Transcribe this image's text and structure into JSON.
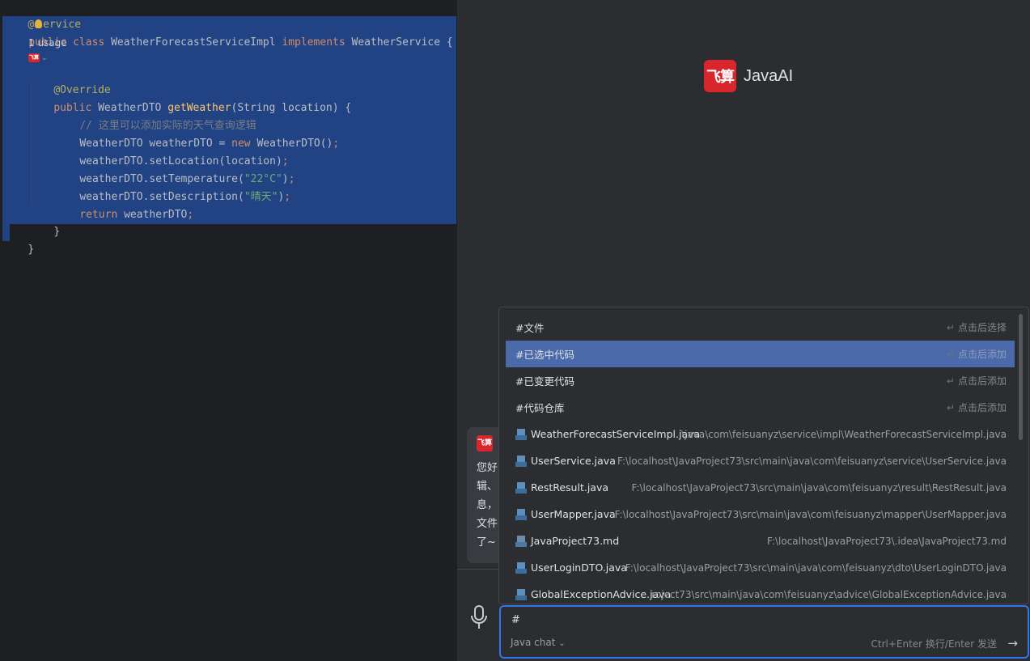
{
  "editor": {
    "lines": {
      "l0": {
        "at": "@",
        "rest": "ervice"
      },
      "l1": {
        "k1": "public",
        "k2": "class",
        "name": "WeatherForecastServiceImpl",
        "k3": "implements",
        "iface": "WeatherService",
        "brace": "{"
      },
      "usage": "1 usage",
      "l3": "@Override",
      "l4": {
        "k1": "public",
        "type": "WeatherDTO",
        "fn": "getWeather",
        "args": "(String location) {"
      },
      "l5": "// 这里可以添加实际的天气查询逻辑",
      "l6": {
        "a": "WeatherDTO weatherDTO = ",
        "kw": "new",
        "b": " WeatherDTO()",
        "semi": ";"
      },
      "l7": {
        "a": "weatherDTO.setLocation(location)",
        "semi": ";"
      },
      "l8": {
        "a": "weatherDTO.setTemperature(",
        "s": "\"22°C\"",
        "b": ")",
        "semi": ";"
      },
      "l9": {
        "a": "weatherDTO.setDescription(",
        "s": "\"晴天\"",
        "b": ")",
        "semi": ";"
      },
      "l10": {
        "kw": "return",
        "a": " weatherDTO",
        "semi": ";"
      },
      "l11": "}",
      "l12": "}"
    }
  },
  "panel": {
    "brand": {
      "logo": "飞算",
      "name": "JavaAI"
    },
    "card": {
      "logo": "飞算",
      "lines": [
        "您好",
        "辑、",
        "息，",
        "文件",
        "了~"
      ]
    },
    "popup": {
      "rows": [
        {
          "name": "#文件",
          "hint": "点击后选择"
        },
        {
          "name": "#已选中代码",
          "hint": "点击后添加"
        },
        {
          "name": "#已变更代码",
          "hint": "点击后添加"
        },
        {
          "name": "#代码仓库",
          "hint": "点击后添加"
        }
      ],
      "files": [
        {
          "name": "WeatherForecastServiceImpl.java",
          "path": "\\java\\com\\feisuanyz\\service\\impl\\WeatherForecastServiceImpl.java"
        },
        {
          "name": "UserService.java",
          "path": "F:\\localhost\\JavaProject73\\src\\main\\java\\com\\feisuanyz\\service\\UserService.java"
        },
        {
          "name": "RestResult.java",
          "path": "F:\\localhost\\JavaProject73\\src\\main\\java\\com\\feisuanyz\\result\\RestResult.java"
        },
        {
          "name": "UserMapper.java",
          "path": "F:\\localhost\\JavaProject73\\src\\main\\java\\com\\feisuanyz\\mapper\\UserMapper.java"
        },
        {
          "name": "JavaProject73.md",
          "path": "F:\\localhost\\JavaProject73\\.idea\\JavaProject73.md"
        },
        {
          "name": "UserLoginDTO.java",
          "path": "F:\\localhost\\JavaProject73\\src\\main\\java\\com\\feisuanyz\\dto\\UserLoginDTO.java"
        },
        {
          "name": "GlobalExceptionAdvice.java",
          "path": "roject73\\src\\main\\java\\com\\feisuanyz\\advice\\GlobalExceptionAdvice.java"
        }
      ]
    },
    "input": {
      "value": "#",
      "model": "Java chat",
      "send_hint": "Ctrl+Enter 换行/Enter 发送"
    }
  },
  "icons": {
    "enter": "enter-key-icon",
    "send": "arrow-right-icon",
    "mic": "microphone-icon"
  }
}
